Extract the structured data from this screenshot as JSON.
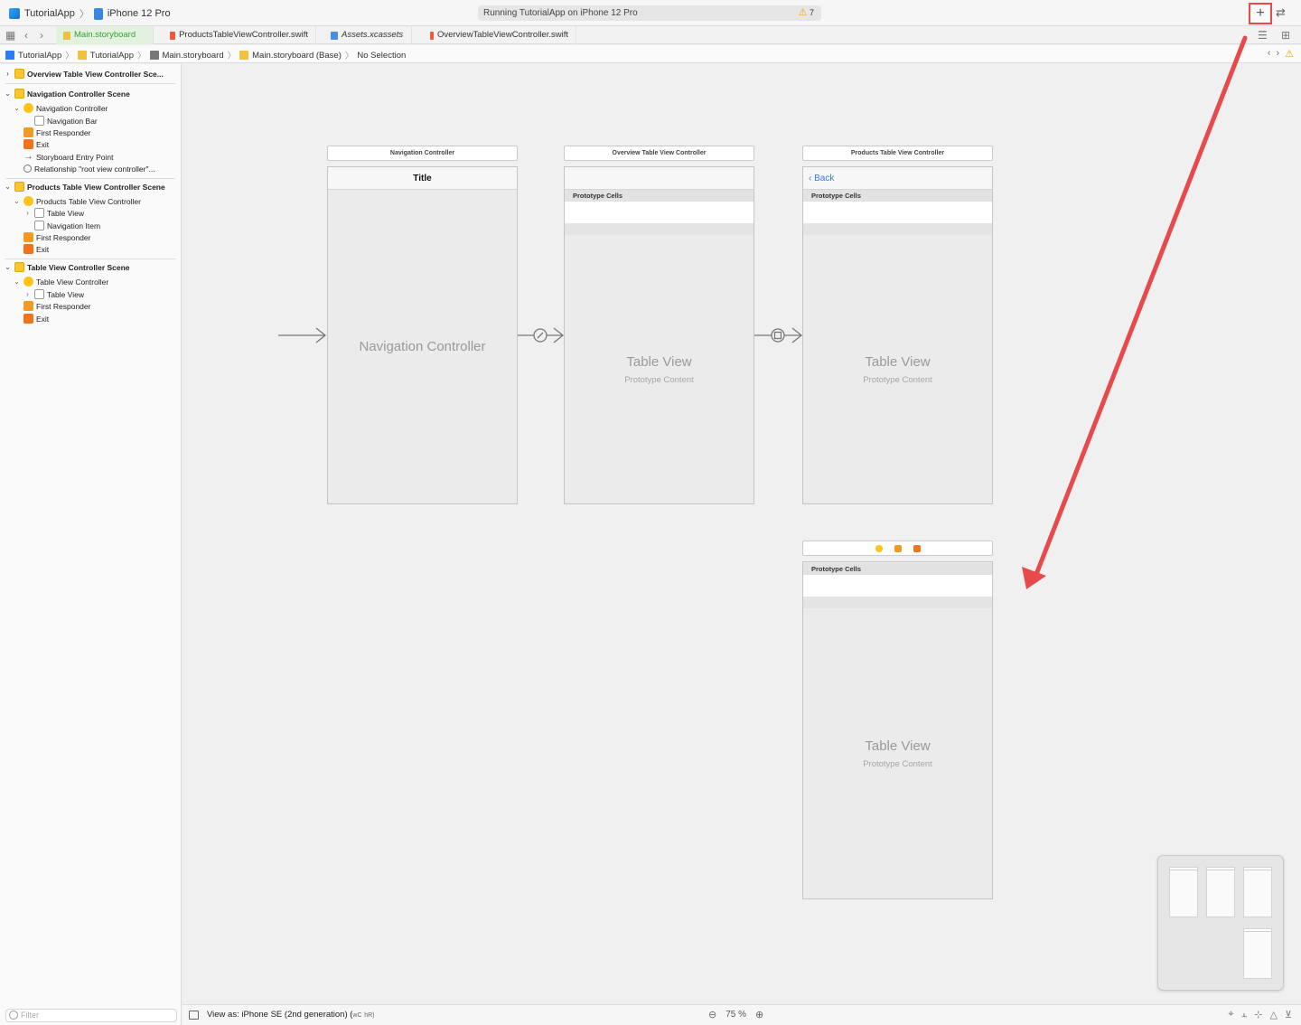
{
  "titlebar": {
    "app": "TutorialApp",
    "device": "iPhone 12 Pro",
    "activity": "Running TutorialApp on iPhone 12 Pro",
    "warning_count": "7",
    "add_icon": "+",
    "swap_icon": "⇄"
  },
  "tabs": [
    {
      "label": "Main.storyboard",
      "icon": "storyboard-icon"
    },
    {
      "label": "ProductsTableViewController.swift",
      "icon": "swift-icon"
    },
    {
      "label": "Assets.xcassets",
      "icon": "assets-icon"
    },
    {
      "label": "OverviewTableViewController.swift",
      "icon": "swift-icon"
    }
  ],
  "jumpbar": {
    "items": [
      "TutorialApp",
      "TutorialApp",
      "Main.storyboard",
      "Main.storyboard (Base)",
      "No Selection"
    ]
  },
  "navigator": {
    "rows": [
      "Overview Table View Controller Sce...",
      "Navigation Controller Scene",
      "Navigation Controller",
      "Navigation Bar",
      "First Responder",
      "Exit",
      "Storyboard Entry Point",
      "Relationship \"root view controller\"...",
      "Products Table View Controller Scene",
      "Products Table View Controller",
      "Table View",
      "Navigation Item",
      "First Responder",
      "Exit",
      "Table View Controller Scene",
      "Table View Controller",
      "Table View",
      "First Responder",
      "Exit"
    ],
    "filter_placeholder": "Filter"
  },
  "canvas": {
    "nav_title_bar": "Navigation Controller",
    "nav_bar_title": "Title",
    "nav_big": "Navigation Controller",
    "overview_title_bar": "Overview Table View Controller",
    "products_title_bar": "Products Table View Controller",
    "back_label": "Back",
    "prototype_cells": "Prototype Cells",
    "table_view": "Table View",
    "prototype_content": "Prototype Content"
  },
  "bottombar": {
    "view_as": "View as: iPhone SE (2nd generation) (",
    "wc": "wC",
    "hr": "hR)",
    "zoom_level": "75 %"
  },
  "colors": {
    "annotation_red": "#e8494a",
    "active_tab_green": "#3a9e3a",
    "link_blue": "#2f7bf2"
  }
}
